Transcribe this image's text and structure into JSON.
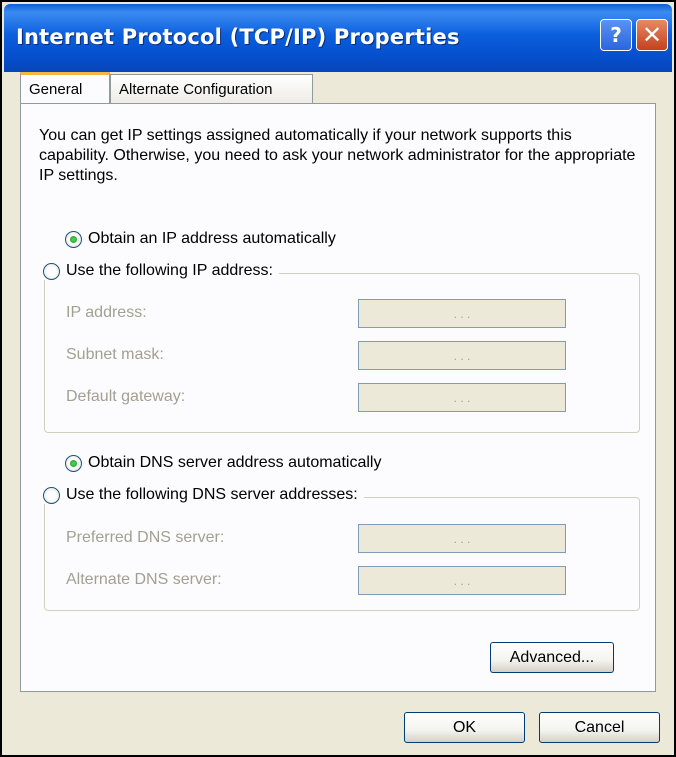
{
  "window": {
    "title": "Internet Protocol (TCP/IP) Properties",
    "help_glyph": "?",
    "close_glyph": "✕"
  },
  "tabs": [
    {
      "label": "General",
      "active": true
    },
    {
      "label": "Alternate Configuration",
      "active": false
    }
  ],
  "general": {
    "description": "You can get IP settings assigned automatically if your network supports this capability. Otherwise, you need to ask your network administrator for the appropriate IP settings.",
    "ip": {
      "auto_label": "Obtain an IP address automatically",
      "manual_label": "Use the following IP address:",
      "selected": "auto",
      "fields": [
        {
          "label": "IP address:",
          "value": ". . ."
        },
        {
          "label": "Subnet mask:",
          "value": ". . ."
        },
        {
          "label": "Default gateway:",
          "value": ". . ."
        }
      ]
    },
    "dns": {
      "auto_label": "Obtain DNS server address automatically",
      "manual_label": "Use the following DNS server addresses:",
      "selected": "auto",
      "fields": [
        {
          "label": "Preferred DNS server:",
          "value": ". . ."
        },
        {
          "label": "Alternate DNS server:",
          "value": ". . ."
        }
      ]
    },
    "advanced_label": "Advanced..."
  },
  "buttons": {
    "ok": "OK",
    "cancel": "Cancel"
  },
  "colors": {
    "titlebar": "#0b5fdd",
    "dialog_bg": "#ece9d8",
    "disabled_text": "#a1a192",
    "radio_selected": "#21a121"
  }
}
